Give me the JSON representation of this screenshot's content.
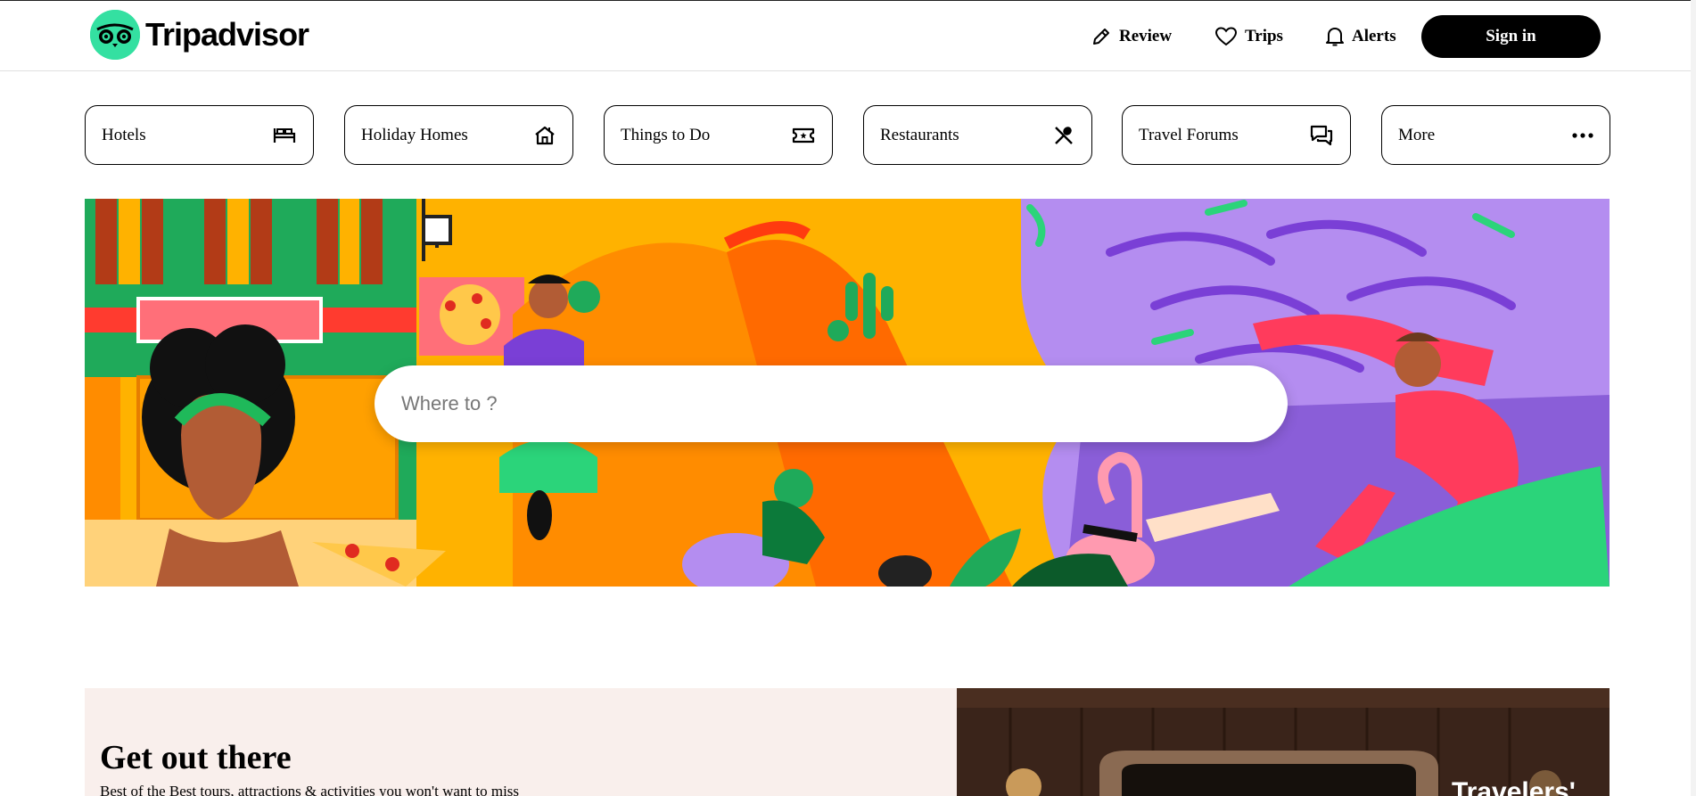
{
  "header": {
    "logo_text": "Tripadvisor",
    "nav": {
      "review": "Review",
      "trips": "Trips",
      "alerts": "Alerts",
      "signin": "Sign in"
    }
  },
  "categories": [
    {
      "label": "Hotels",
      "icon": "bed-icon"
    },
    {
      "label": "Holiday Homes",
      "icon": "home-icon"
    },
    {
      "label": "Things to Do",
      "icon": "ticket-icon"
    },
    {
      "label": "Restaurants",
      "icon": "utensils-icon"
    },
    {
      "label": "Travel Forums",
      "icon": "chat-icon"
    },
    {
      "label": "More",
      "icon": "more-dots-icon"
    }
  ],
  "search": {
    "placeholder": "Where to ?"
  },
  "promo": {
    "title": "Get out there",
    "subtitle": "Best of the Best tours, attractions & activities you won't want to miss",
    "photo_caption": "Travelers'"
  },
  "colors": {
    "brand_green": "#34e0a1",
    "black": "#000000",
    "promo_bg": "#f9efec"
  }
}
